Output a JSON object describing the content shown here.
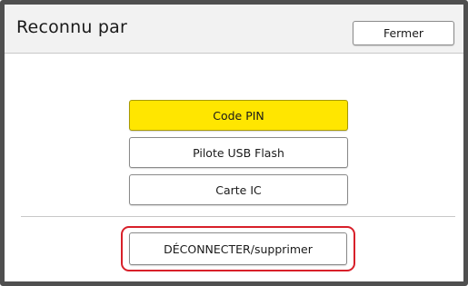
{
  "header": {
    "title": "Reconnu par",
    "close_label": "Fermer"
  },
  "options": [
    {
      "label": "Code PIN",
      "selected": true
    },
    {
      "label": "Pilote USB Flash",
      "selected": false
    },
    {
      "label": "Carte IC",
      "selected": false
    }
  ],
  "footer": {
    "disconnect_label": "DÉCONNECTER/supprimer",
    "highlighted": true
  },
  "colors": {
    "selected_fill": "#ffe600",
    "highlight_border": "#d8202a",
    "frame": "#4f4f4f"
  }
}
